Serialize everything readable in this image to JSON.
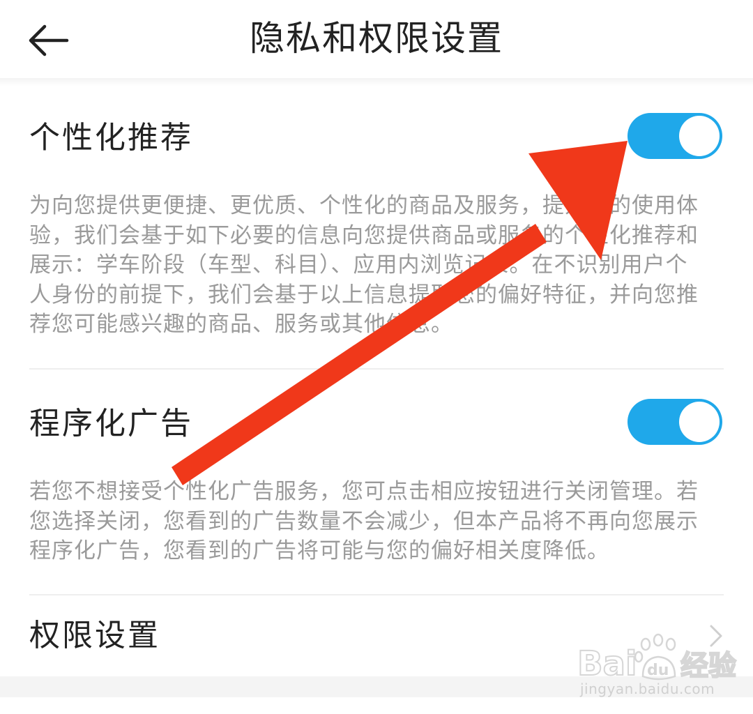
{
  "header": {
    "title": "隐私和权限设置",
    "back_icon": "arrow-left-icon"
  },
  "sections": [
    {
      "title": "个性化推荐",
      "toggle_on": true,
      "description_lines": [
        "为向您提供更便捷、更优质、个性化的商品及服务，提升您的使用体",
        "验，我们会基于如下必要的信息向您提供商品或服务的个性化推荐和",
        "展示：学车阶段（车型、科目）、应用内浏览记录。在不识别用户个",
        "人身份的前提下，我们会基于以上信息提取您的偏好特征，并向您推",
        "荐您可能感兴趣的商品、服务或其他信息。"
      ]
    },
    {
      "title": "程序化广告",
      "toggle_on": true,
      "description_lines": [
        "若您不想接受个性化广告服务，您可点击相应按钮进行关闭管理。若",
        "您选择关闭，您看到的广告数量不会减少，但本产品将不再向您展示",
        "程序化广告，您看到的广告将可能与您的偏好相关度降低。"
      ]
    },
    {
      "title": "权限设置",
      "chevron_icon": "chevron-right-icon"
    }
  ],
  "watermark": {
    "brand": "Baidu",
    "brand_cn": "经验",
    "url": "jingyan.baidu.com"
  },
  "colors": {
    "toggle_on": "#1fa8ea",
    "annotation_arrow": "#f0381a",
    "title_text": "#222222",
    "desc_text": "#9a9a9a"
  }
}
